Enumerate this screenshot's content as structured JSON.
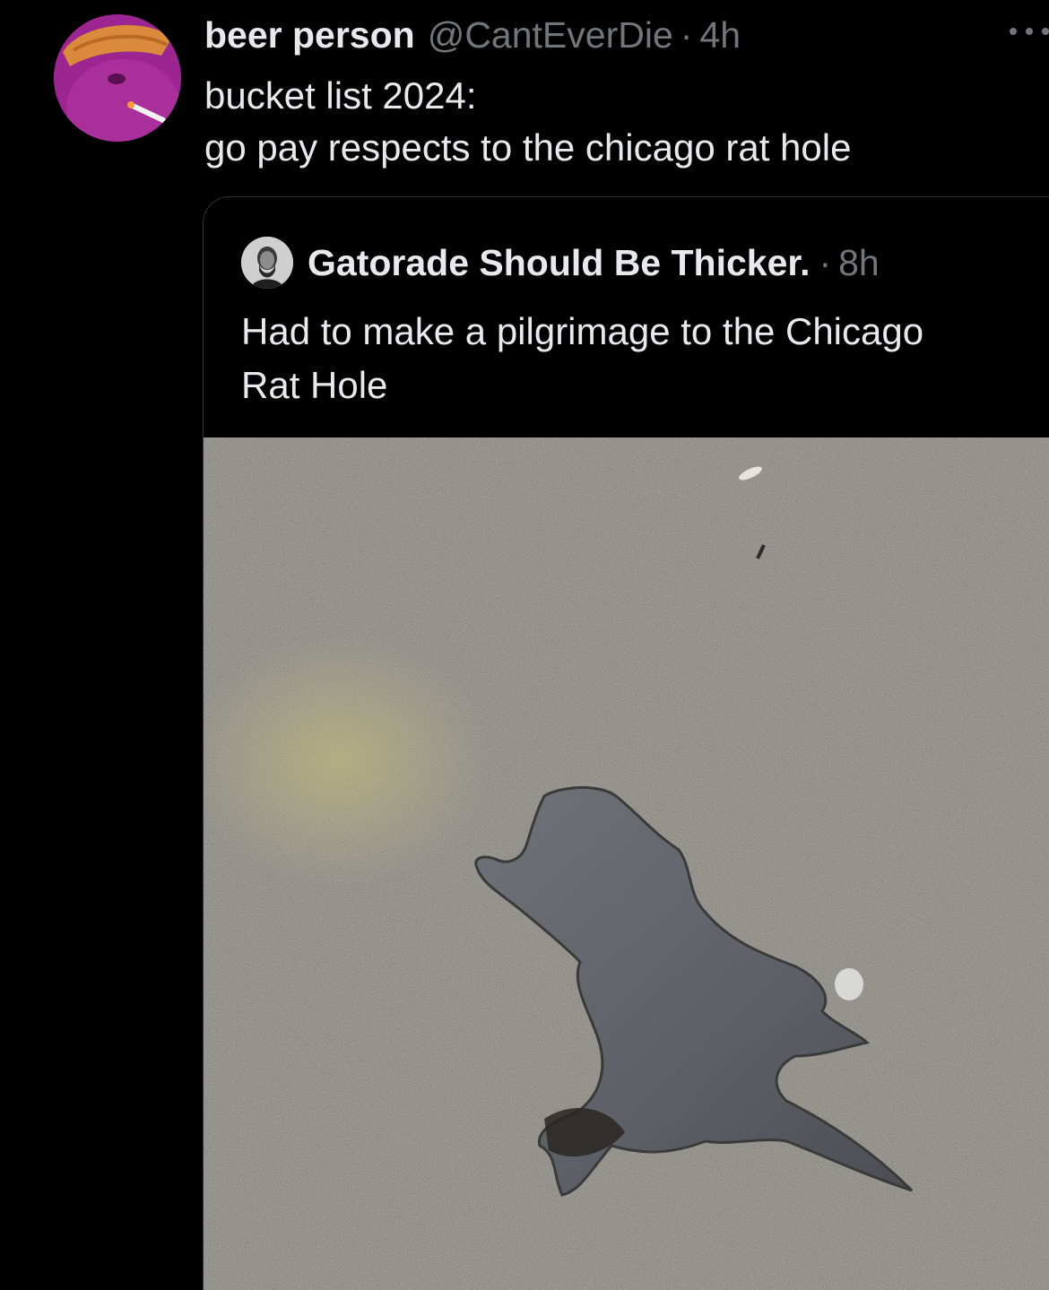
{
  "tweet": {
    "display_name": "beer person",
    "handle": "@CantEverDie",
    "separator": "·",
    "time": "4h",
    "text_lines": [
      "bucket list 2024:",
      "go pay respects to the chicago rat hole"
    ],
    "more_icon": "more-horizontal-icon"
  },
  "quote": {
    "display_name": "Gatorade Should Be Thicker.",
    "separator": "·",
    "time": "8h",
    "text_lines": [
      "Had to make a pilgrimage to the Chicago",
      "Rat Hole"
    ]
  },
  "colors": {
    "background": "#000000",
    "primary_text": "#e7e9ea",
    "secondary_text": "#71767b",
    "border": "#2f3336"
  }
}
